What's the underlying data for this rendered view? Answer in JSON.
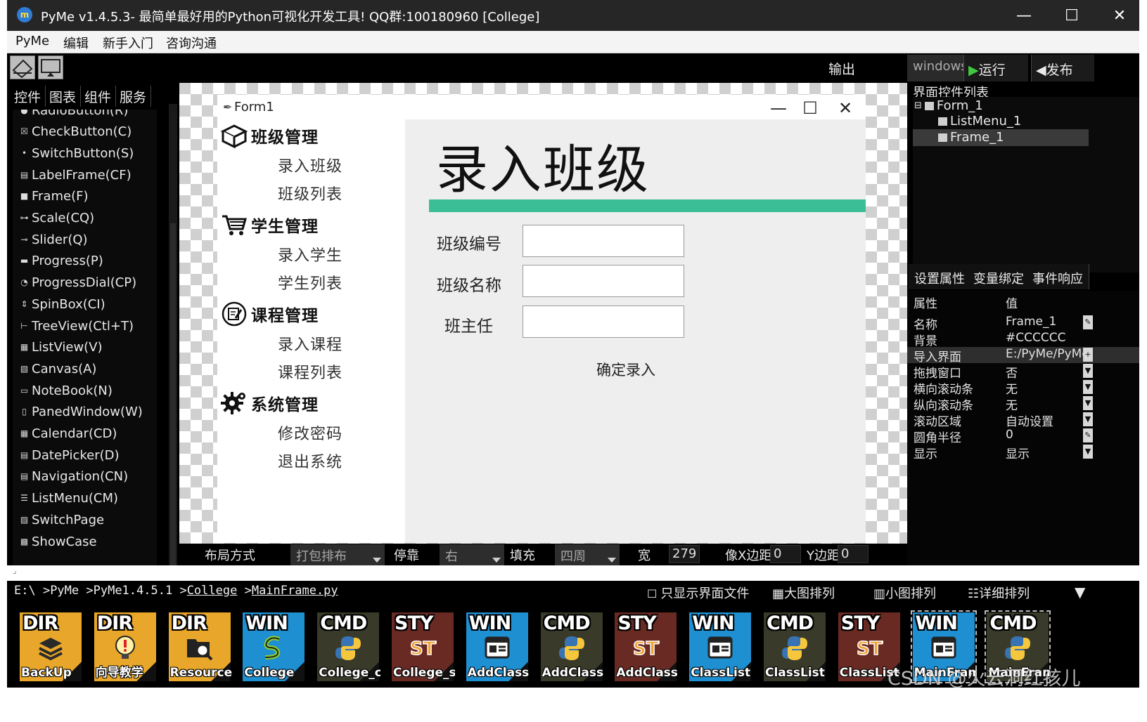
{
  "window": {
    "logo_text": "m",
    "title": "PyMe v1.4.5.3- 最简单最好用的Python可视化开发工具! QQ群:100180960    [College]",
    "controls": [
      "—",
      "☐",
      "✕"
    ]
  },
  "menubar": [
    "PyMe",
    "编辑",
    "新手入门",
    "咨询沟通"
  ],
  "toolbar": {
    "output_label": "输出",
    "platform_value": "windows",
    "run_label": "运行",
    "publish_label": "发布"
  },
  "left_panel": {
    "tabs": [
      "控件",
      "图表",
      "组件",
      "服务"
    ],
    "controls": [
      {
        "label": "RadioButton(R)",
        "icon": "radio-icon",
        "glyph": "●"
      },
      {
        "label": "CheckButton(C)",
        "icon": "checkbox-icon",
        "glyph": "☒"
      },
      {
        "label": "SwitchButton(S)",
        "icon": "switch-icon",
        "glyph": "•"
      },
      {
        "label": "LabelFrame(CF)",
        "icon": "labelframe-icon",
        "glyph": "▤"
      },
      {
        "label": "Frame(F)",
        "icon": "frame-icon",
        "glyph": "■"
      },
      {
        "label": "Scale(CQ)",
        "icon": "scale-icon",
        "glyph": "⊶"
      },
      {
        "label": "Slider(Q)",
        "icon": "slider-icon",
        "glyph": "⊸"
      },
      {
        "label": "Progress(P)",
        "icon": "progress-icon",
        "glyph": "▬"
      },
      {
        "label": "ProgressDial(CP)",
        "icon": "dial-icon",
        "glyph": "◔"
      },
      {
        "label": "SpinBox(CI)",
        "icon": "spinbox-icon",
        "glyph": "⇕"
      },
      {
        "label": "TreeView(Ctl+T)",
        "icon": "treeview-icon",
        "glyph": "⊢"
      },
      {
        "label": "ListView(V)",
        "icon": "listview-icon",
        "glyph": "▦"
      },
      {
        "label": "Canvas(A)",
        "icon": "canvas-icon",
        "glyph": "▧"
      },
      {
        "label": "NoteBook(N)",
        "icon": "notebook-icon",
        "glyph": "▭"
      },
      {
        "label": "PanedWindow(W)",
        "icon": "panedwindow-icon",
        "glyph": "▯"
      },
      {
        "label": "Calendar(CD)",
        "icon": "calendar-icon",
        "glyph": "▦"
      },
      {
        "label": "DatePicker(D)",
        "icon": "datepicker-icon",
        "glyph": "▤"
      },
      {
        "label": "Navigation(CN)",
        "icon": "navigation-icon",
        "glyph": "▤"
      },
      {
        "label": "ListMenu(CM)",
        "icon": "listmenu-icon",
        "glyph": "☰"
      },
      {
        "label": "SwitchPage",
        "icon": "switchpage-icon",
        "glyph": "▨"
      },
      {
        "label": "ShowCase",
        "icon": "showcase-icon",
        "glyph": "▩"
      }
    ]
  },
  "form": {
    "title": "Form1",
    "controls": [
      "—",
      "☐",
      "✕"
    ],
    "menu": [
      {
        "label": "班级管理",
        "icon": "box-icon",
        "items": [
          "录入班级",
          "班级列表"
        ]
      },
      {
        "label": "学生管理",
        "icon": "cart-icon",
        "items": [
          "录入学生",
          "学生列表"
        ]
      },
      {
        "label": "课程管理",
        "icon": "edit-icon",
        "items": [
          "录入课程",
          "课程列表"
        ]
      },
      {
        "label": "系统管理",
        "icon": "gear-icon",
        "items": [
          "修改密码",
          "退出系统"
        ]
      }
    ],
    "frame": {
      "heading": "录入班级",
      "accent_color": "#3bbd96",
      "fields": [
        {
          "label": "班级编号",
          "value": ""
        },
        {
          "label": "班级名称",
          "value": ""
        },
        {
          "label": "班主任",
          "value": ""
        }
      ],
      "submit_label": "确定录入"
    }
  },
  "property_bar": {
    "layout_label": "布局方式",
    "layout_value": "打包排布",
    "dock_label": "停靠",
    "dock_value": "右",
    "fill_label": "填充",
    "fill_value": "四周",
    "width_label": "宽",
    "width_value": "279",
    "padx_label": "像X边距",
    "padx_value": "0",
    "pady_label": "Y边距",
    "pady_value": "0"
  },
  "right_panel": {
    "title": "界面控件列表",
    "tree": [
      {
        "label": "Form_1",
        "expander": "⊟"
      },
      {
        "label": "ListMenu_1"
      },
      {
        "label": "Frame_1"
      }
    ],
    "tabs": [
      "设置属性",
      "变量绑定",
      "事件响应"
    ],
    "header": {
      "key": "属性",
      "value": "值"
    },
    "properties": [
      {
        "key": "名称",
        "value": "Frame_1",
        "btn": "✎"
      },
      {
        "key": "背景",
        "value": "#CCCCCC",
        "btn": ""
      },
      {
        "key": "导入界面",
        "value": "E:/PyMe/PyMe",
        "btn": "+"
      },
      {
        "key": "拖拽窗口",
        "value": "否",
        "btn": "▼"
      },
      {
        "key": "横向滚动条",
        "value": "无",
        "btn": "▼"
      },
      {
        "key": "纵向滚动条",
        "value": "无",
        "btn": "▼"
      },
      {
        "key": "滚动区域",
        "value": "自动设置",
        "btn": "▼"
      },
      {
        "key": "圆角半径",
        "value": "0",
        "btn": "✎"
      },
      {
        "key": "显示",
        "value": "显示",
        "btn": "▼"
      }
    ]
  },
  "file_browser": {
    "path_parts": [
      "E:\\",
      " >PyMe",
      " >PyMe1.4.5.1",
      " >",
      "College",
      " >",
      "MainFrame.py"
    ],
    "only_ui_label": "只显示界面文件",
    "large_icons_label": "大图排列",
    "small_icons_label": "小图排列",
    "detail_label": "详细排列",
    "files": [
      {
        "type": "DIR",
        "name": "BackUp",
        "color": "#e8a72a",
        "icon": "layers-icon"
      },
      {
        "type": "DIR",
        "name": "向导教学",
        "color": "#e8a72a",
        "icon": "bulb-icon"
      },
      {
        "type": "DIR",
        "name": "Resource",
        "color": "#e8a72a",
        "icon": "folder-search-icon"
      },
      {
        "type": "WIN",
        "name": "College",
        "color": "#1e8fd0",
        "icon": "snake-icon"
      },
      {
        "type": "CMD",
        "name": "College_cmd",
        "color": "#3a3a2a",
        "icon": "python-icon"
      },
      {
        "type": "STY",
        "name": "College_sty",
        "color": "#6a2a24",
        "icon": "sty-icon"
      },
      {
        "type": "WIN",
        "name": "AddClass",
        "color": "#1e8fd0",
        "icon": "window-icon"
      },
      {
        "type": "CMD",
        "name": "AddClass",
        "color": "#3a3a2a",
        "icon": "python-icon"
      },
      {
        "type": "STY",
        "name": "AddClass",
        "color": "#6a2a24",
        "icon": "sty-icon"
      },
      {
        "type": "WIN",
        "name": "ClassList",
        "color": "#1e8fd0",
        "icon": "window-icon"
      },
      {
        "type": "CMD",
        "name": "ClassList",
        "color": "#3a3a2a",
        "icon": "python-icon"
      },
      {
        "type": "STY",
        "name": "ClassList",
        "color": "#6a2a24",
        "icon": "sty-icon"
      },
      {
        "type": "WIN",
        "name": "MainFrame",
        "color": "#1e8fd0",
        "icon": "window-icon"
      },
      {
        "type": "CMD",
        "name": "MainFrame",
        "color": "#3a3a2a",
        "icon": "python-icon"
      }
    ]
  },
  "watermark": "CSDN @火云洞红孩儿"
}
